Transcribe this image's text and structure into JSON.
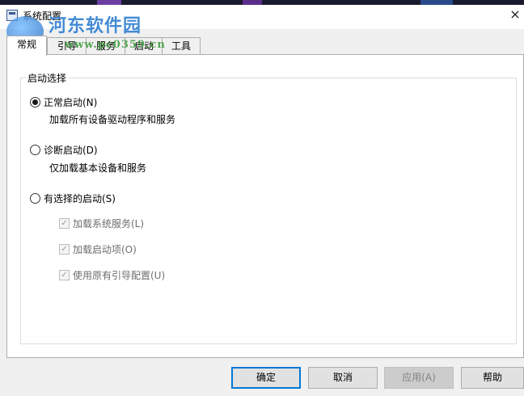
{
  "window": {
    "title": "系统配置",
    "close": "×"
  },
  "watermark": {
    "site_name": "河东软件园",
    "url": "www.pc0359.cn"
  },
  "tabs": [
    {
      "label": "常规",
      "active": true
    },
    {
      "label": "引导",
      "active": false
    },
    {
      "label": "服务",
      "active": false
    },
    {
      "label": "启动",
      "active": false
    },
    {
      "label": "工具",
      "active": false
    }
  ],
  "startup": {
    "legend": "启动选择",
    "normal": {
      "label": "正常启动(N)",
      "desc": "加载所有设备驱动程序和服务",
      "checked": true
    },
    "diagnostic": {
      "label": "诊断启动(D)",
      "desc": "仅加载基本设备和服务",
      "checked": false
    },
    "selective": {
      "label": "有选择的启动(S)",
      "checked": false,
      "options": [
        {
          "label": "加载系统服务(L)",
          "checked": true,
          "enabled": false
        },
        {
          "label": "加载启动项(O)",
          "checked": true,
          "enabled": false
        },
        {
          "label": "使用原有引导配置(U)",
          "checked": true,
          "enabled": false
        }
      ]
    }
  },
  "footer": {
    "ok": "确定",
    "cancel": "取消",
    "apply": "应用(A)",
    "help": "帮助"
  },
  "colors": {
    "accent": "#0078d7",
    "watermark_blue": "#2f7fd1",
    "watermark_green": "#3a9a3a"
  }
}
